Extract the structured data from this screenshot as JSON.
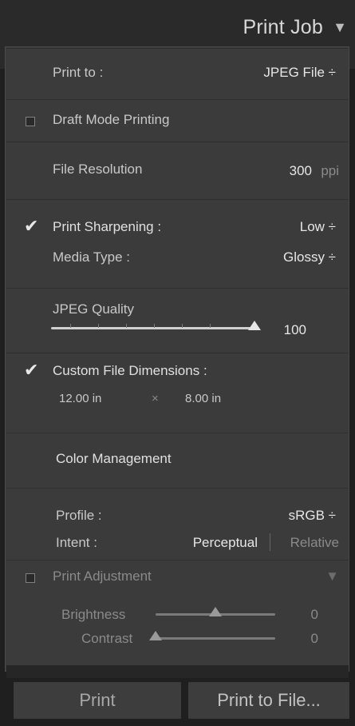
{
  "panel": {
    "title": "Print Job",
    "collapse_icon": "triangle-down-icon"
  },
  "print_to": {
    "label": "Print to :",
    "value": "JPEG File ÷"
  },
  "draft_mode": {
    "label": "Draft Mode Printing",
    "checked": false
  },
  "file_resolution": {
    "label": "File Resolution",
    "value": "300",
    "unit": "ppi"
  },
  "print_sharpening": {
    "label": "Print Sharpening :",
    "checked": true,
    "value": "Low ÷",
    "media_type_label": "Media Type :",
    "media_type_value": "Glossy ÷"
  },
  "jpeg_quality": {
    "label": "JPEG Quality",
    "value": "100",
    "level": 1.0
  },
  "custom_dimensions": {
    "label": "Custom File Dimensions :",
    "checked": true,
    "width": "12.00 in",
    "separator": "×",
    "height": "8.00 in"
  },
  "color_management": {
    "title": "Color Management",
    "profile_label": "Profile :",
    "profile_value": "sRGB ÷",
    "intent_label": "Intent :",
    "intent_perceptual": "Perceptual",
    "intent_relative": "Relative"
  },
  "print_adjustment": {
    "label": "Print Adjustment",
    "checked": false,
    "collapse_icon": "triangle-down-icon",
    "brightness_label": "Brightness",
    "brightness_value": "0",
    "brightness_level": 0.5,
    "contrast_label": "Contrast",
    "contrast_value": "0",
    "contrast_level": 0.0
  },
  "buttons": {
    "print": "Print",
    "print_to_file": "Print to File..."
  },
  "colors": {
    "panel_bg": "#3b3b3b",
    "header_bg": "#2a2a2a",
    "text": "#cfcfcf"
  }
}
